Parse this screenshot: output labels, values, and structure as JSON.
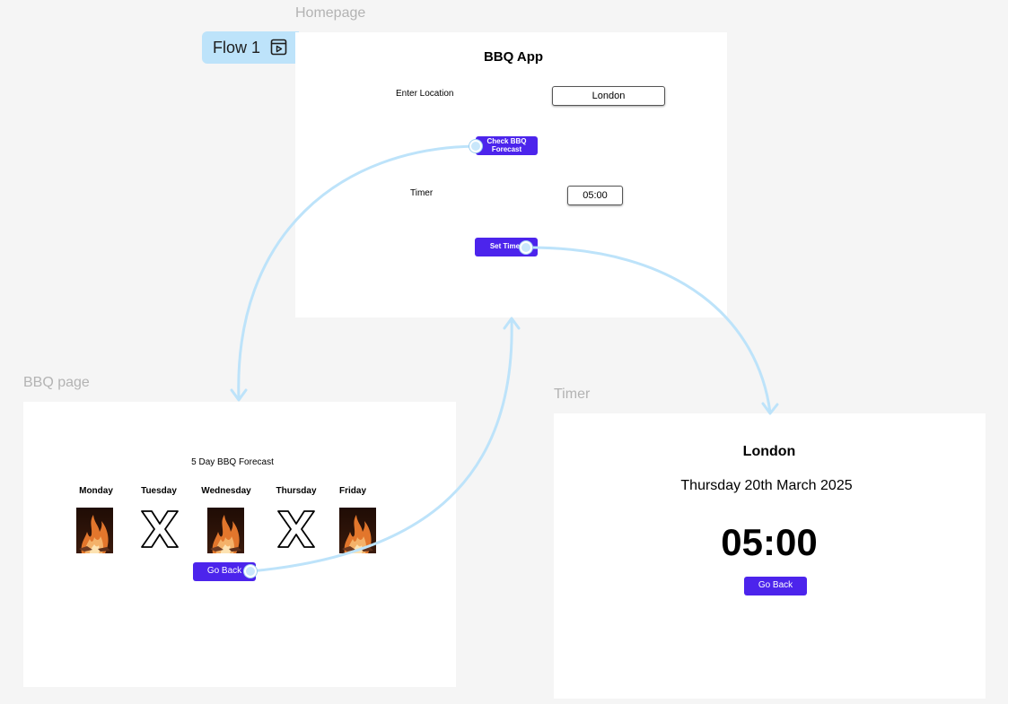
{
  "canvas": {
    "flow": {
      "label": "Flow 1",
      "icon": "play-frame-icon"
    },
    "connector_color": "#bde3fa",
    "accent_color": "#4c24ec"
  },
  "homepage": {
    "frame_label": "Homepage",
    "title": "BBQ App",
    "location_label": "Enter Location",
    "location_value": "London",
    "forecast_button": "Check BBQ Forecast",
    "timer_label": "Timer",
    "timer_value": "05:00",
    "set_timer_button": "Set Timer"
  },
  "bbq_page": {
    "frame_label": "BBQ page",
    "heading": "5 Day BBQ Forecast",
    "days": [
      {
        "name": "Monday",
        "icon": "fire-icon"
      },
      {
        "name": "Tuesday",
        "icon": "x-icon"
      },
      {
        "name": "Wednesday",
        "icon": "fire-icon"
      },
      {
        "name": "Thursday",
        "icon": "x-icon"
      },
      {
        "name": "Friday",
        "icon": "fire-icon"
      }
    ],
    "back_button": "Go Back"
  },
  "timer_page": {
    "frame_label": "Timer",
    "city": "London",
    "date": "Thursday 20th March 2025",
    "countdown": "05:00",
    "back_button": "Go Back"
  }
}
